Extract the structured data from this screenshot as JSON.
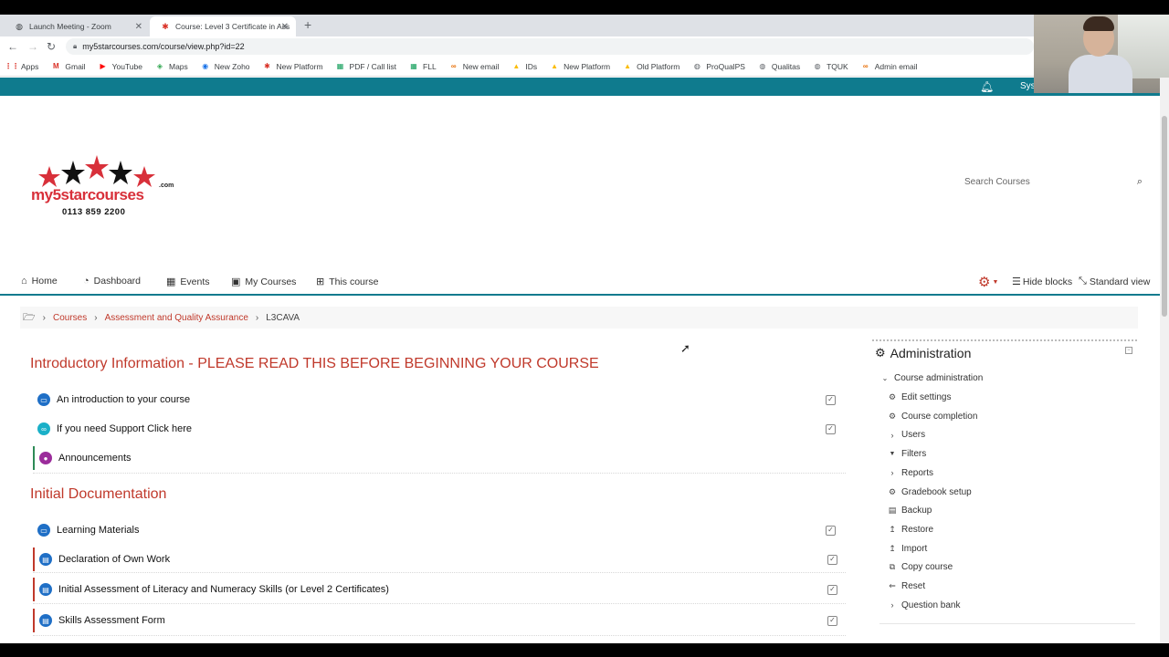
{
  "browser": {
    "tabs": [
      {
        "label": "Launch Meeting - Zoom",
        "icon": "globe-icon"
      },
      {
        "label": "Course: Level 3 Certificate in Ass",
        "icon": "my5star-favicon"
      }
    ],
    "new_tab_symbol": "+",
    "url": "my5starcourses.com/course/view.php?id=22",
    "bookmarks": [
      {
        "label": "Apps",
        "icon": "apps-grid-icon",
        "color": "#d93025"
      },
      {
        "label": "Gmail",
        "icon": "gmail-icon",
        "color": "#d93025"
      },
      {
        "label": "YouTube",
        "icon": "youtube-icon",
        "color": "#ff0000"
      },
      {
        "label": "Maps",
        "icon": "maps-icon",
        "color": "#34a853"
      },
      {
        "label": "New Zoho",
        "icon": "zoho-icon",
        "color": "#1a73e8"
      },
      {
        "label": "New Platform",
        "icon": "star-icon",
        "color": "#d93025"
      },
      {
        "label": "PDF / Call list",
        "icon": "sheets-icon",
        "color": "#0f9d58"
      },
      {
        "label": "FLL",
        "icon": "sheets-icon",
        "color": "#0f9d58"
      },
      {
        "label": "New email",
        "icon": "link-icon",
        "color": "#e8710a"
      },
      {
        "label": "IDs",
        "icon": "drive-icon",
        "color": "#fbbc04"
      },
      {
        "label": "New Platform",
        "icon": "drive-icon",
        "color": "#fbbc04"
      },
      {
        "label": "Old Platform",
        "icon": "drive-icon",
        "color": "#fbbc04"
      },
      {
        "label": "ProQualPS",
        "icon": "globe-icon",
        "color": "#5f6368"
      },
      {
        "label": "Qualitas",
        "icon": "globe-icon",
        "color": "#5f6368"
      },
      {
        "label": "TQUK",
        "icon": "globe-icon",
        "color": "#5f6368"
      },
      {
        "label": "Admin email",
        "icon": "link-icon",
        "color": "#e8710a"
      }
    ]
  },
  "header": {
    "user_partial": "Sys",
    "logo": {
      "text": "my5starcourses",
      "suffix": ".com",
      "phone": "0113 859 2200"
    },
    "search_placeholder": "Search Courses"
  },
  "nav": {
    "items": [
      {
        "label": "Home",
        "icon": "home-icon"
      },
      {
        "label": "Dashboard",
        "icon": "dashboard-icon"
      },
      {
        "label": "Events",
        "icon": "calendar-icon"
      },
      {
        "label": "My Courses",
        "icon": "briefcase-icon"
      },
      {
        "label": "This course",
        "icon": "sitemap-icon"
      }
    ],
    "hide_blocks": "Hide blocks",
    "standard_view": "Standard view"
  },
  "breadcrumb": {
    "items": [
      "Courses",
      "Assessment and Quality Assurance"
    ],
    "current": "L3CAVA"
  },
  "sections": [
    {
      "title": "Introductory Information - PLEASE READ THIS BEFORE BEGINNING YOUR COURSE",
      "activities": [
        {
          "label": "An introduction to your course",
          "icon": "folder-icon",
          "color": "#1f6fc6"
        },
        {
          "label": "If you need Support Click here",
          "icon": "url-link-icon",
          "color": "#1ab0c8"
        },
        {
          "label": "Announcements",
          "icon": "forum-icon",
          "color": "#9b2c9b"
        }
      ]
    },
    {
      "title": "Initial Documentation",
      "activities": [
        {
          "label": "Learning Materials",
          "icon": "folder-icon",
          "color": "#1f6fc6"
        },
        {
          "label": "Declaration of Own Work",
          "icon": "assignment-icon",
          "color": "#1f6fc6"
        },
        {
          "label": "Initial Assessment of Literacy and Numeracy Skills (or Level 2 Certificates)",
          "icon": "assignment-icon",
          "color": "#1f6fc6"
        },
        {
          "label": "Skills Assessment Form",
          "icon": "assignment-icon",
          "color": "#1f6fc6"
        }
      ]
    }
  ],
  "admin": {
    "title": "Administration",
    "course_admin": "Course administration",
    "items": [
      {
        "label": "Edit settings",
        "icon": "gear-icon"
      },
      {
        "label": "Course completion",
        "icon": "gear-icon"
      },
      {
        "label": "Users",
        "icon": "chevron-right-icon"
      },
      {
        "label": "Filters",
        "icon": "filter-icon"
      },
      {
        "label": "Reports",
        "icon": "chevron-right-icon"
      },
      {
        "label": "Gradebook setup",
        "icon": "gear-icon"
      },
      {
        "label": "Backup",
        "icon": "file-icon"
      },
      {
        "label": "Restore",
        "icon": "upload-icon"
      },
      {
        "label": "Import",
        "icon": "upload-icon"
      },
      {
        "label": "Copy course",
        "icon": "copy-icon"
      },
      {
        "label": "Reset",
        "icon": "arrow-left-icon"
      },
      {
        "label": "Question bank",
        "icon": "chevron-right-icon"
      }
    ]
  },
  "colors": {
    "teal": "#0f7b8e",
    "accent_red": "#c0392b"
  }
}
